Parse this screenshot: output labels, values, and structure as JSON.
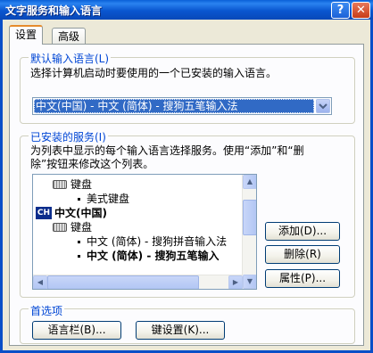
{
  "window": {
    "title": "文字服务和输入语言",
    "help_label": "?",
    "close_label": "✕"
  },
  "tabs": [
    {
      "label": "设置",
      "active": true
    },
    {
      "label": "高级",
      "active": false
    }
  ],
  "default_language": {
    "group_label": "默认输入语言(L)",
    "description": "选择计算机启动时要使用的一个已安装的输入语言。",
    "selected": "中文(中国) - 中文 (简体) - 搜狗五笔输入法"
  },
  "installed_services": {
    "group_label": "已安装的服务(I)",
    "description_line1": "为列表中显示的每个输入语言选择服务。使用“添加”和“删",
    "description_line2": "除”按钮来修改这个列表。",
    "tree": [
      {
        "label": "键盘",
        "icon": "keyboard-icon"
      },
      {
        "label": "美式键盘",
        "icon": "bullet"
      },
      {
        "label": "中文(中国)",
        "icon": "ch-language-icon",
        "badge": "CH"
      },
      {
        "label": "键盘",
        "icon": "keyboard-icon"
      },
      {
        "label": "中文 (简体) - 搜狗拼音输入法",
        "icon": "bullet"
      },
      {
        "label": "中文 (简体) - 搜狗五笔输入",
        "icon": "bullet"
      }
    ],
    "buttons": {
      "add": "添加(D)...",
      "remove": "删除(R)",
      "properties": "属性(P)..."
    }
  },
  "preferences": {
    "group_label": "首选项",
    "language_bar": "语言栏(B)...",
    "key_settings": "键设置(K)..."
  },
  "colors": {
    "titlebar": "#0a56d0",
    "group_label": "#0046d5",
    "selection": "#316ac5",
    "dialog_bg": "#ece9d8"
  }
}
